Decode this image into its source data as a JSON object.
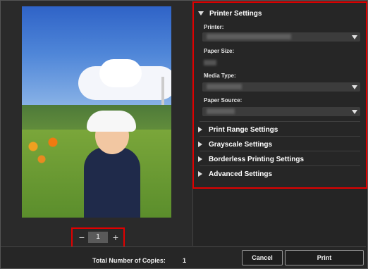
{
  "preview": {
    "page_number": "1",
    "minus_glyph": "−",
    "plus_glyph": "+"
  },
  "settings": {
    "printer_settings_title": "Printer Settings",
    "printer_label": "Printer:",
    "paper_size_label": "Paper Size:",
    "media_type_label": "Media Type:",
    "paper_source_label": "Paper Source:",
    "sections": [
      "Print Range Settings",
      "Grayscale Settings",
      "Borderless Printing Settings",
      "Advanced Settings"
    ]
  },
  "footer": {
    "copies_label": "Total Number of Copies:",
    "copies_value": "1",
    "cancel_label": "Cancel",
    "print_label": "Print"
  },
  "colors": {
    "highlight": "#e00000",
    "background": "#262626"
  }
}
